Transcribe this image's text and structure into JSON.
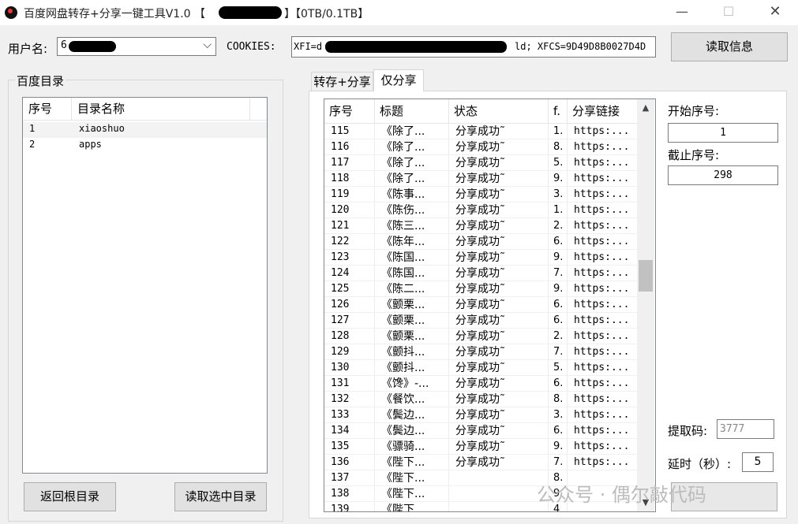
{
  "window": {
    "title_prefix": "百度网盘转存+分享一键工具V1.0 【",
    "title_suffix": "】【0TB/0.1TB】",
    "min_glyph": "—",
    "max_glyph": "☐",
    "close_glyph": "✕"
  },
  "top": {
    "username_label": "用户名:",
    "username_value": "6",
    "username_arrow": "⌵",
    "cookies_label": "COOKIES:",
    "cookies_prefix": "XFI=d",
    "cookies_suffix": "ld; XFCS=9D49D8B0027D4D",
    "read_info_button": "读取信息"
  },
  "left": {
    "group_title": "百度目录",
    "headers": [
      "序号",
      "目录名称"
    ],
    "rows": [
      {
        "no": "1",
        "name": "xiaoshuo"
      },
      {
        "no": "2",
        "name": "apps"
      }
    ],
    "back_root_button": "返回根目录",
    "read_selected_button": "读取选中目录"
  },
  "tabs": [
    {
      "label": "转存+分享",
      "active": false
    },
    {
      "label": "仅分享",
      "active": true
    }
  ],
  "share_table": {
    "headers": [
      "序号",
      "标题",
      "状态",
      "f.",
      "分享链接"
    ],
    "rows": [
      {
        "no": "115",
        "title": "《除了...",
        "status": "分享成功˜",
        "f": "1.",
        "link": "https:..."
      },
      {
        "no": "116",
        "title": "《除了...",
        "status": "分享成功˜",
        "f": "8.",
        "link": "https:..."
      },
      {
        "no": "117",
        "title": "《除了...",
        "status": "分享成功˜",
        "f": "5.",
        "link": "https:..."
      },
      {
        "no": "118",
        "title": "《除了...",
        "status": "分享成功˜",
        "f": "9.",
        "link": "https:..."
      },
      {
        "no": "119",
        "title": "《陈事...",
        "status": "分享成功˜",
        "f": "3.",
        "link": "https:..."
      },
      {
        "no": "120",
        "title": "《陈伤...",
        "status": "分享成功˜",
        "f": "1.",
        "link": "https:..."
      },
      {
        "no": "121",
        "title": "《陈三...",
        "status": "分享成功˜",
        "f": "2.",
        "link": "https:..."
      },
      {
        "no": "122",
        "title": "《陈年...",
        "status": "分享成功˜",
        "f": "6.",
        "link": "https:..."
      },
      {
        "no": "123",
        "title": "《陈国...",
        "status": "分享成功˜",
        "f": "9.",
        "link": "https:..."
      },
      {
        "no": "124",
        "title": "《陈国...",
        "status": "分享成功˜",
        "f": "7.",
        "link": "https:..."
      },
      {
        "no": "125",
        "title": "《陈二...",
        "status": "分享成功˜",
        "f": "9.",
        "link": "https:..."
      },
      {
        "no": "126",
        "title": "《颤栗...",
        "status": "分享成功˜",
        "f": "6.",
        "link": "https:..."
      },
      {
        "no": "127",
        "title": "《颤栗...",
        "status": "分享成功˜",
        "f": "6.",
        "link": "https:..."
      },
      {
        "no": "128",
        "title": "《颤栗...",
        "status": "分享成功˜",
        "f": "2.",
        "link": "https:..."
      },
      {
        "no": "129",
        "title": "《颤抖...",
        "status": "分享成功˜",
        "f": "7.",
        "link": "https:..."
      },
      {
        "no": "130",
        "title": "《颤抖...",
        "status": "分享成功˜",
        "f": "5.",
        "link": "https:..."
      },
      {
        "no": "131",
        "title": "《馋》-...",
        "status": "分享成功˜",
        "f": "6.",
        "link": "https:..."
      },
      {
        "no": "132",
        "title": "《餐饮...",
        "status": "分享成功˜",
        "f": "8.",
        "link": "https:..."
      },
      {
        "no": "133",
        "title": "《鬓边...",
        "status": "分享成功˜",
        "f": "3.",
        "link": "https:..."
      },
      {
        "no": "134",
        "title": "《鬓边...",
        "status": "分享成功˜",
        "f": "6.",
        "link": "https:..."
      },
      {
        "no": "135",
        "title": "《骠骑...",
        "status": "分享成功˜",
        "f": "9.",
        "link": "https:..."
      },
      {
        "no": "136",
        "title": "《陛下...",
        "status": "分享成功˜",
        "f": "7.",
        "link": "https:..."
      },
      {
        "no": "137",
        "title": "《陛下...",
        "status": "",
        "f": "8.",
        "link": ""
      },
      {
        "no": "138",
        "title": "《陛下...",
        "status": "",
        "f": "9.",
        "link": ""
      },
      {
        "no": "139",
        "title": "《陛下",
        "status": "",
        "f": "4",
        "link": ""
      }
    ],
    "scroll_up": "▲",
    "scroll_down": "▼"
  },
  "settings": {
    "start_label": "开始序号:",
    "start_value": "1",
    "end_label": "截止序号:",
    "end_value": "298",
    "code_label": "提取码:",
    "code_value": "3777",
    "delay_label": "延时（秒）:",
    "delay_value": "5"
  },
  "watermark": "公众号 · 偶尔敲代码"
}
